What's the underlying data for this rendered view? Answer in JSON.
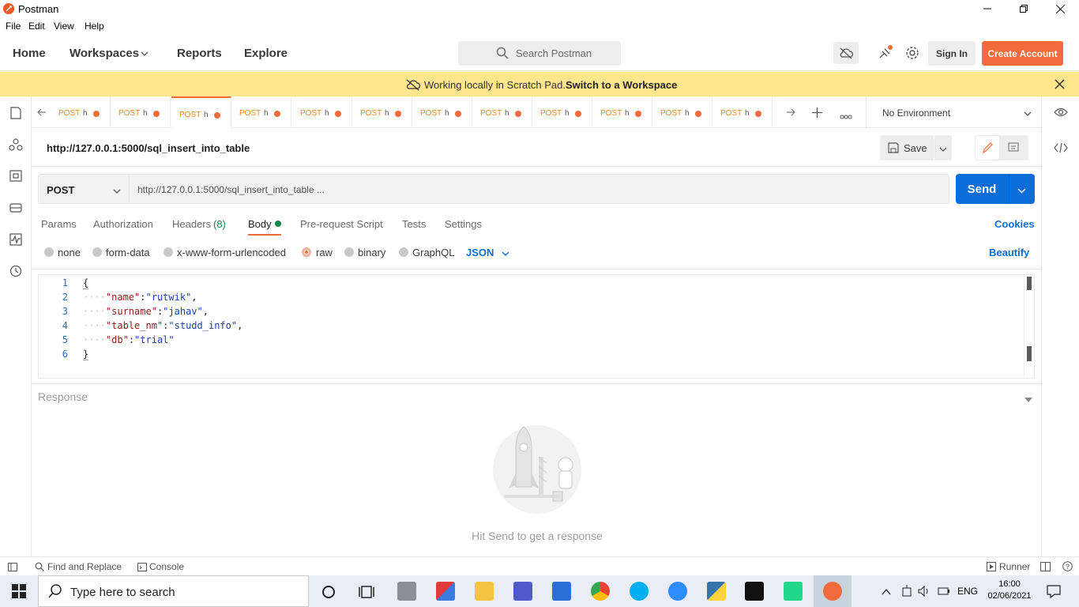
{
  "window": {
    "title": "Postman"
  },
  "menu": [
    "File",
    "Edit",
    "View",
    "Help"
  ],
  "header": {
    "nav": [
      "Home",
      "Workspaces",
      "Reports",
      "Explore"
    ],
    "search_placeholder": "Search Postman",
    "sign_in": "Sign In",
    "create_account": "Create Account"
  },
  "banner": {
    "text": "Working locally in Scratch Pad.",
    "link": "Switch to a Workspace"
  },
  "tabs": [
    {
      "method": "POST",
      "cut": "h"
    },
    {
      "method": "POST",
      "cut": "h"
    },
    {
      "method": "POST",
      "cut": "h"
    },
    {
      "method": "POST",
      "cut": "h"
    },
    {
      "method": "POST",
      "cut": "h"
    },
    {
      "method": "POST",
      "cut": "h"
    },
    {
      "method": "POST",
      "cut": "h"
    },
    {
      "method": "POST",
      "cut": "h"
    },
    {
      "method": "POST",
      "cut": "h"
    },
    {
      "method": "POST",
      "cut": "h"
    },
    {
      "method": "POST",
      "cut": "h"
    },
    {
      "method": "POST",
      "cut": "h"
    }
  ],
  "active_tab_index": 2,
  "environment": "No Environment",
  "request": {
    "title": "http://127.0.0.1:5000/sql_insert_into_table",
    "save": "Save",
    "method": "POST",
    "url": "http://127.0.0.1:5000/sql_insert_into_table ...",
    "send": "Send"
  },
  "subtabs": {
    "params": "Params",
    "authorization": "Authorization",
    "headers": "Headers",
    "headers_count": "(8)",
    "body": "Body",
    "prerequest": "Pre-request Script",
    "tests": "Tests",
    "settings": "Settings",
    "cookies": "Cookies"
  },
  "body_types": {
    "none": "none",
    "form_data": "form-data",
    "urlencoded": "x-www-form-urlencoded",
    "raw": "raw",
    "binary": "binary",
    "graphql": "GraphQL",
    "format": "JSON",
    "beautify": "Beautify",
    "selected": "raw"
  },
  "code": {
    "line_numbers": [
      "1",
      "2",
      "3",
      "4",
      "5",
      "6"
    ],
    "open": "{",
    "close": "}",
    "indent": "····",
    "fields": [
      {
        "key": "\"name\"",
        "value": "\"rutwik\"",
        "comma": ","
      },
      {
        "key": "\"surname\"",
        "value": "\"jahav\"",
        "comma": ","
      },
      {
        "key": "\"table_nm\"",
        "value": "\"studd_info\"",
        "comma": ","
      },
      {
        "key": "\"db\"",
        "value": "\"trial\"",
        "comma": ""
      }
    ]
  },
  "response": {
    "title": "Response",
    "empty": "Hit Send to get a response"
  },
  "statusbar": {
    "find": "Find and Replace",
    "console": "Console",
    "runner": "Runner"
  },
  "taskbar": {
    "search": "Type here to search",
    "lang": "ENG",
    "time": "16:00",
    "date": "02/06/2021"
  },
  "colors": {
    "accent": "#f26b3a",
    "send": "#0b6ed8",
    "banner": "#fde68b",
    "link_blue": "#0b6ed8"
  }
}
